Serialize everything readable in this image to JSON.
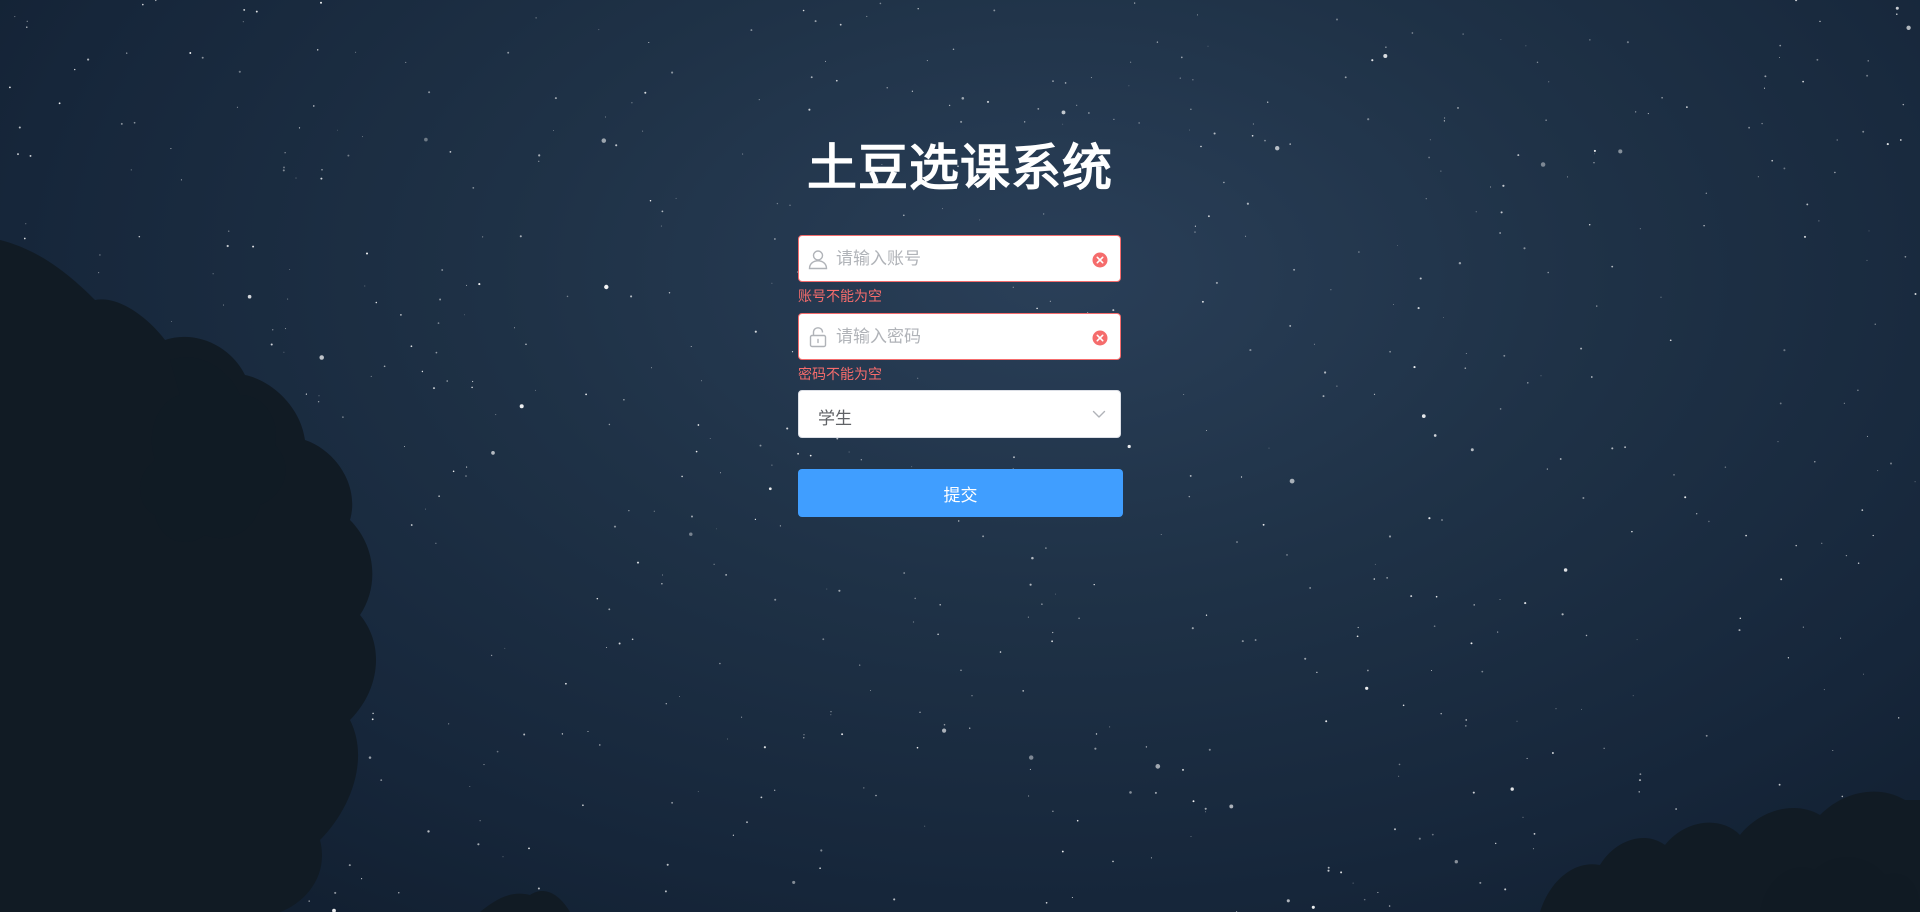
{
  "page": {
    "title": "土豆选课系统"
  },
  "form": {
    "account": {
      "placeholder": "请输入账号",
      "value": "",
      "error": "账号不能为空",
      "icon": "user-icon"
    },
    "password": {
      "placeholder": "请输入密码",
      "value": "",
      "error": "密码不能为空",
      "icon": "lock-icon"
    },
    "role": {
      "selected": "学生",
      "icon": "chevron-down-icon"
    },
    "submit_label": "提交"
  },
  "colors": {
    "error": "#f56c6c",
    "primary": "#409eff",
    "background": "#1f3247"
  }
}
